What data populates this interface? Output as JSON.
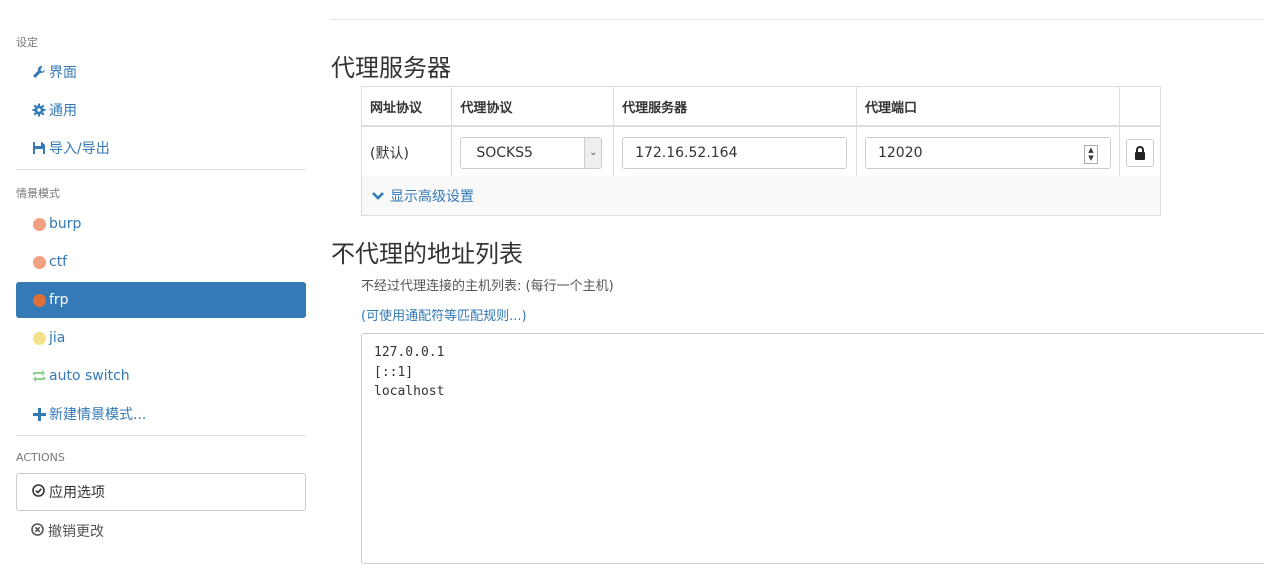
{
  "sidebar": {
    "settings_header": "设定",
    "settings_items": [
      {
        "label": "界面",
        "icon": "wrench-icon"
      },
      {
        "label": "通用",
        "icon": "gear-icon"
      },
      {
        "label": "导入/导出",
        "icon": "floppy-icon"
      }
    ],
    "profiles_header": "情景模式",
    "profiles": [
      {
        "label": "burp",
        "icon": "globe-icon",
        "color": "#f0a080"
      },
      {
        "label": "ctf",
        "icon": "globe-icon",
        "color": "#f0a080"
      },
      {
        "label": "frp",
        "icon": "globe-icon",
        "color": "#e0703a",
        "active": true
      },
      {
        "label": "jia",
        "icon": "globe-icon",
        "color": "#f5e08a"
      },
      {
        "label": "auto switch",
        "icon": "refresh-icon",
        "color": "#8bd28b"
      }
    ],
    "new_profile": "新建情景模式...",
    "actions_header": "ACTIONS",
    "apply_label": "应用选项",
    "discard_label": "撤销更改"
  },
  "main": {
    "proxy_title": "代理服务器",
    "table": {
      "headers": [
        "网址协议",
        "代理协议",
        "代理服务器",
        "代理端口"
      ],
      "row": {
        "scheme": "(默认)",
        "protocol": "SOCKS5",
        "server": "172.16.52.164",
        "port": "12020"
      }
    },
    "advanced_label": "显示高级设置",
    "bypass_title": "不代理的地址列表",
    "bypass_desc": "不经过代理连接的主机列表: (每行一个主机)",
    "bypass_rules_link": "(可使用通配符等匹配规则...)",
    "bypass_list": [
      "127.0.0.1",
      "[::1]",
      "localhost"
    ]
  },
  "colors": {
    "accent": "#337ab7"
  }
}
